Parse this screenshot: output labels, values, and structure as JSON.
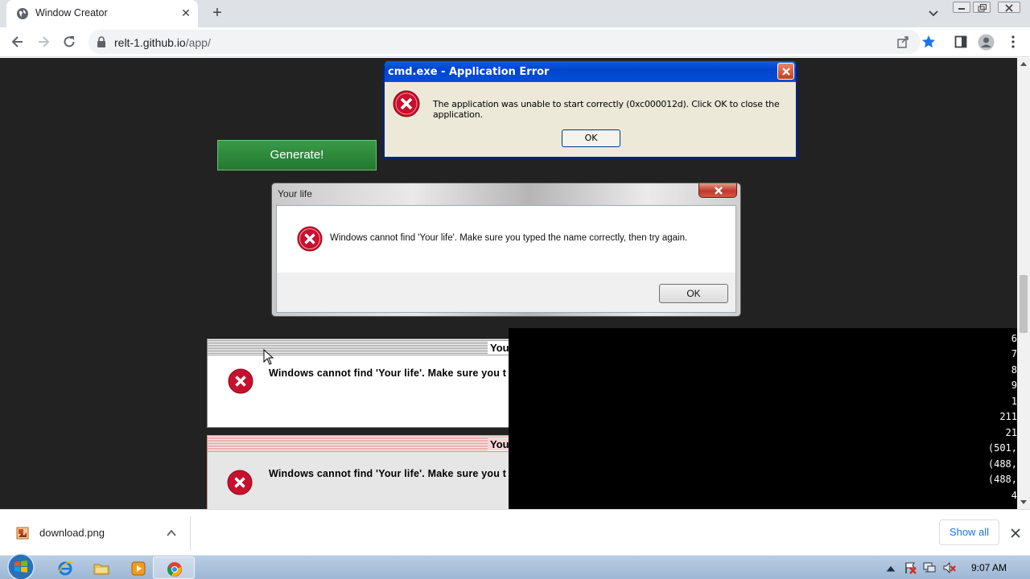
{
  "browser": {
    "tab_title": "Window Creator",
    "url_host": "relt-1.github.io",
    "url_path": "/app/"
  },
  "page": {
    "generate_label": "Generate!",
    "xp_dialog": {
      "title": "cmd.exe - Application Error",
      "message": "The application was unable to start correctly (0xc000012d). Click OK to close the application.",
      "ok_label": "OK"
    },
    "win7_dialog": {
      "title": "Your life",
      "message": "Windows cannot find 'Your life'. Make sure you typed the name correctly, then try again.",
      "ok_label": "OK"
    },
    "classic_dialogs": [
      {
        "title": "Your",
        "message": "Windows cannot find 'Your life'. Make sure you t"
      },
      {
        "title": "Your",
        "message": "Windows cannot find 'Your life'. Make sure you t"
      }
    ],
    "terminal_lines": [
      "6",
      "7",
      "8",
      "9",
      "1",
      "211",
      "21",
      "(501,",
      "(488,",
      "(488,",
      "4"
    ]
  },
  "downloads": {
    "file_name": "download.png",
    "show_all_label": "Show all"
  },
  "taskbar": {
    "clock": "9:07 AM"
  },
  "colors": {
    "page_bg": "#222222",
    "generate_green": "#2e8a3b",
    "xp_title_blue": "#0050d8",
    "error_red": "#c8102e",
    "link_blue": "#1a73e8"
  }
}
